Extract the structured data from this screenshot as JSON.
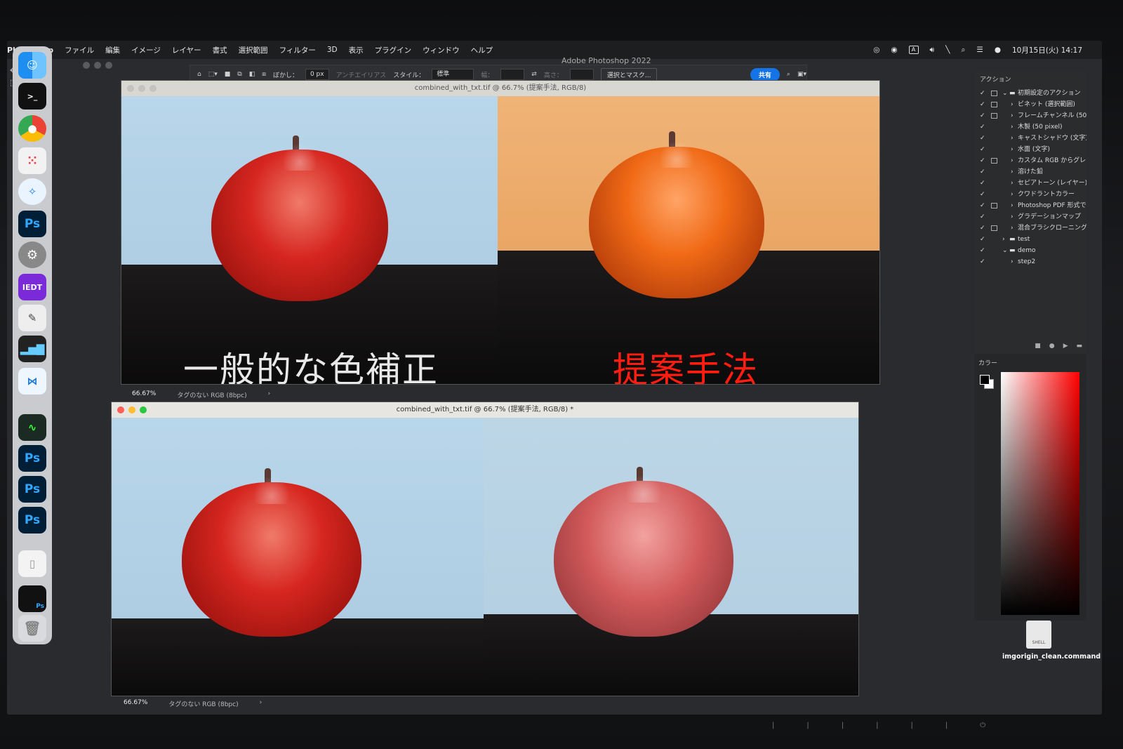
{
  "menubar": {
    "app_name": "Photoshop",
    "items": [
      "ファイル",
      "編集",
      "イメージ",
      "レイヤー",
      "書式",
      "選択範囲",
      "フィルター",
      "3D",
      "表示",
      "プラグイン",
      "ウィンドウ",
      "ヘルプ"
    ],
    "clock": "10月15日(火) 14:17"
  },
  "app_title": "Adobe Photoshop 2022",
  "options_bar": {
    "feather_label": "ぼかし：",
    "feather_value": "0 px",
    "antialias_label": "アンチエイリアス",
    "style_label": "スタイル：",
    "style_value": "標準",
    "width_label": "幅：",
    "height_label": "高さ：",
    "select_mask_label": "選択とマスク...",
    "share_label": "共有"
  },
  "window1": {
    "title": "combined_with_txt.tif @ 66.7% (提案手法, RGB/8)",
    "caption_left": "一般的な色補正",
    "caption_right": "提案手法",
    "zoom": "66.67%",
    "profile": "タグのない RGB (8bpc)"
  },
  "window2": {
    "title": "combined_with_txt.tif @ 66.7% (提案手法, RGB/8) *",
    "zoom": "66.67%",
    "profile": "タグのない RGB (8bpc)"
  },
  "actions_panel": {
    "title": "アクション",
    "rows": [
      {
        "label": "初期設定のアクション",
        "box": true,
        "level": 0,
        "folder": true,
        "open": true
      },
      {
        "label": "ビネット (選択範囲)",
        "box": true,
        "level": 1
      },
      {
        "label": "フレームチャンネル (50",
        "box": true,
        "level": 1
      },
      {
        "label": "木製 (50 pixel)",
        "box": false,
        "level": 1
      },
      {
        "label": "キャストシャドウ (文字)",
        "box": false,
        "level": 1
      },
      {
        "label": "水面 (文字)",
        "box": false,
        "level": 1
      },
      {
        "label": "カスタム RGB からグレー",
        "box": true,
        "level": 1
      },
      {
        "label": "溶けた鉛",
        "box": false,
        "level": 1
      },
      {
        "label": "セピアトーン (レイヤー)",
        "box": false,
        "level": 1
      },
      {
        "label": "クワドラントカラー",
        "box": false,
        "level": 1
      },
      {
        "label": "Photoshop PDF 形式で",
        "box": true,
        "level": 1
      },
      {
        "label": "グラデーションマップ",
        "box": false,
        "level": 1
      },
      {
        "label": "混合ブラシクローニング",
        "box": true,
        "level": 1
      },
      {
        "label": "test",
        "box": false,
        "level": 0,
        "folder": true
      },
      {
        "label": "demo",
        "box": false,
        "level": 0,
        "folder": true,
        "open": true
      },
      {
        "label": "step2",
        "box": false,
        "level": 1
      }
    ]
  },
  "color_panel": {
    "title": "カラー"
  },
  "desktop_file": {
    "label": "imgorigin_clean.command",
    "icon_text": "SHELL"
  },
  "dock": {
    "items": [
      "finder",
      "terminal",
      "chrome",
      "launchpad",
      "safari",
      "Ps",
      "system-settings",
      "IEDT",
      "pencil",
      "histogram",
      "vscode",
      "activity-monitor",
      "Ps",
      "Ps",
      "Ps",
      "document",
      "ps-window",
      "trash"
    ]
  },
  "colors": {
    "left_bg_top": "#b9d6ea",
    "right_bg_top": "#f0b477",
    "apple_red": "#d6261f",
    "apple_orange": "#f06a16",
    "caption_white": "#e8e8e8",
    "caption_red": "#ff1c10",
    "share_blue": "#1473e6"
  }
}
